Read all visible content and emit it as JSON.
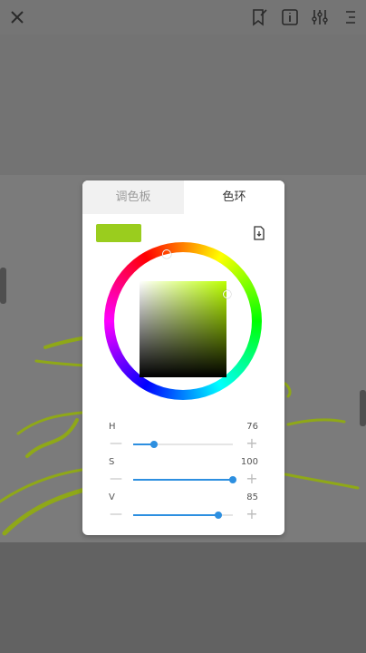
{
  "app": {
    "toolbar": {
      "close_icon": "close-icon",
      "icons": [
        "bookmark-edit-icon",
        "info-icon",
        "sliders-icon",
        "menu-icon"
      ]
    }
  },
  "color_panel": {
    "tabs": [
      {
        "label": "调色板",
        "active": false
      },
      {
        "label": "色环",
        "active": true
      }
    ],
    "current_color": "#9ACD1E",
    "import_icon": "import-file-icon",
    "hsv": [
      {
        "label": "H",
        "value": "76",
        "fraction": 0.21
      },
      {
        "label": "S",
        "value": "100",
        "fraction": 1.0
      },
      {
        "label": "V",
        "value": "85",
        "fraction": 0.85
      }
    ]
  },
  "colors": {
    "accent": "#2D8FE0",
    "stroke_color": "#8FA818"
  }
}
